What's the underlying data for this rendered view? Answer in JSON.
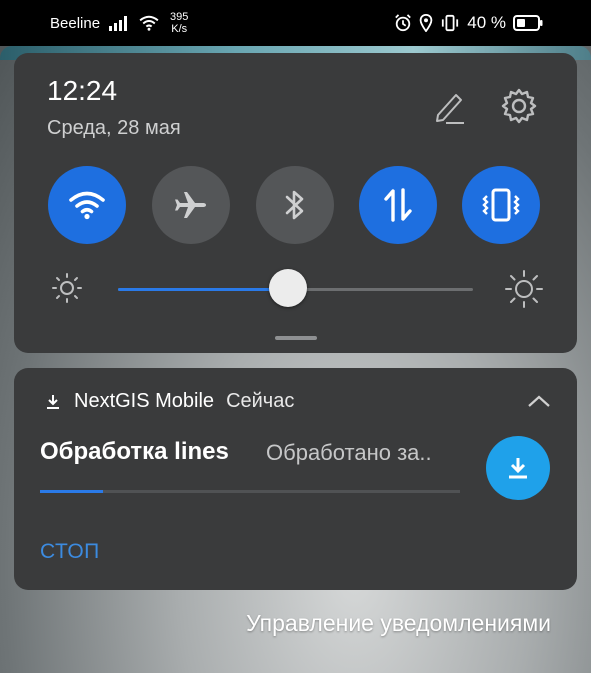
{
  "status_bar": {
    "carrier": "Beeline",
    "speed_value": "395",
    "speed_unit": "K/s",
    "battery_percent": "40 %",
    "icons": [
      "signal-icon",
      "wifi-icon",
      "alarm-icon",
      "location-icon",
      "vibrate-icon",
      "battery-icon"
    ]
  },
  "quick_settings": {
    "time": "12:24",
    "date": "Среда, 28 мая",
    "tiles": [
      {
        "name": "wifi",
        "icon": "wifi-icon",
        "on": true
      },
      {
        "name": "airplane",
        "icon": "airplane-icon",
        "on": false
      },
      {
        "name": "bluetooth",
        "icon": "bluetooth-icon",
        "on": false
      },
      {
        "name": "mobile-data",
        "icon": "data-arrows-icon",
        "on": true
      },
      {
        "name": "vibrate",
        "icon": "vibrate-icon",
        "on": true
      }
    ],
    "brightness_level": 0.48,
    "colors": {
      "accent": "#1e6fe0",
      "off_tile": "#545658",
      "panel": "#3a3b3c"
    }
  },
  "notification": {
    "app_name": "NextGIS Mobile",
    "time": "Сейчас",
    "title": "Обработка lines",
    "text": "Обработано за..",
    "progress": 0.15,
    "action_stop": "СТОП",
    "button_color": "#1fa1ea"
  },
  "footer": {
    "manage_label": "Управление уведомлениями"
  }
}
